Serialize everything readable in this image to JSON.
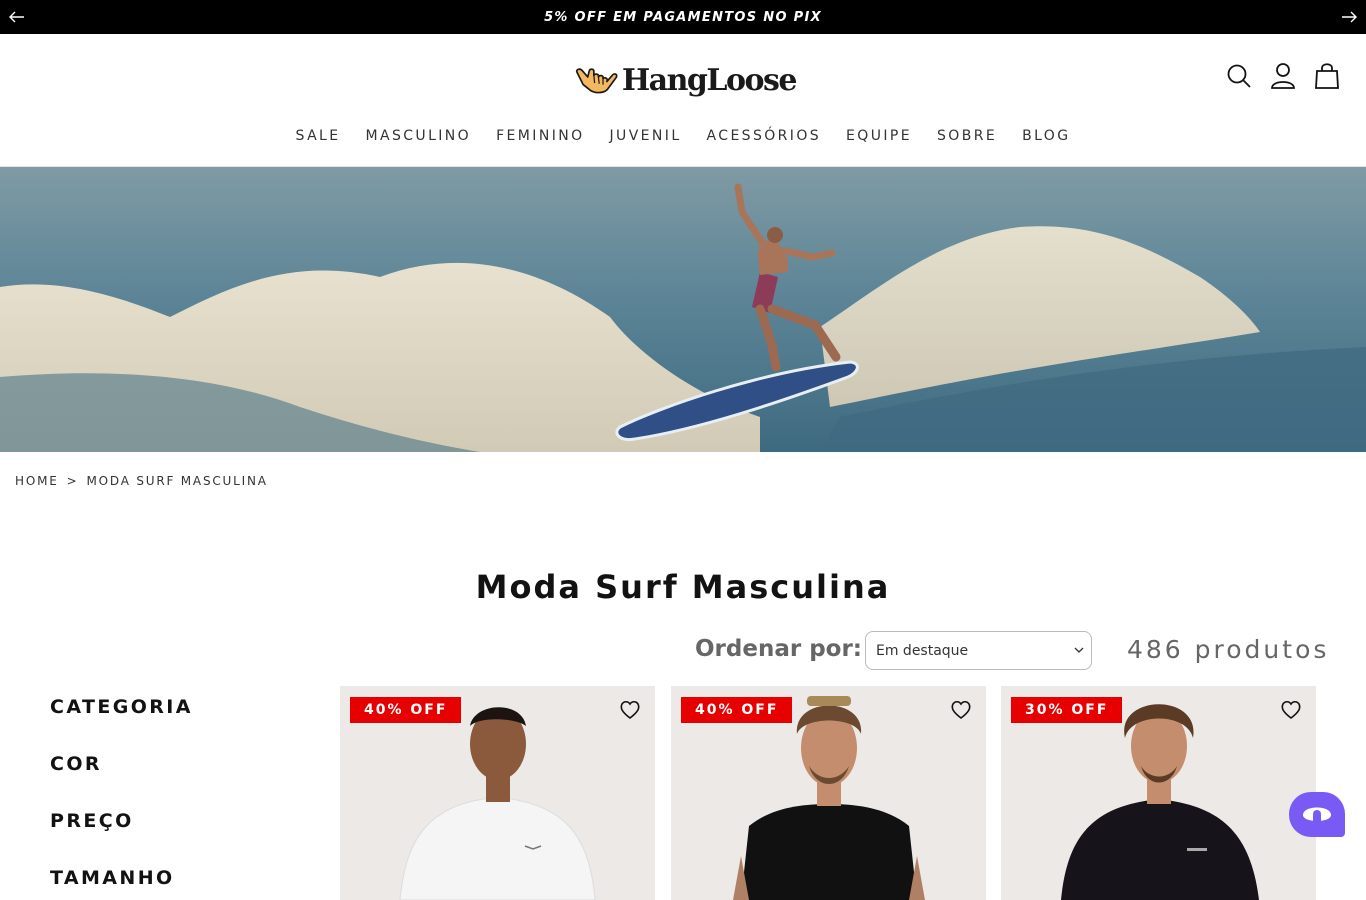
{
  "announcement": {
    "text": "5% OFF EM PAGAMENTOS NO PIX"
  },
  "header": {
    "logo_text": "HangLoose",
    "nav": [
      "SALE",
      "MASCULINO",
      "FEMININO",
      "JUVENIL",
      "ACESSÓRIOS",
      "EQUIPE",
      "SOBRE",
      "BLOG"
    ],
    "icons": [
      "search-icon",
      "account-icon",
      "bag-icon"
    ]
  },
  "breadcrumb": {
    "home": "HOME",
    "separator": ">",
    "current": "MODA SURF MASCULINA"
  },
  "page": {
    "title": "Moda Surf Masculina"
  },
  "sort": {
    "label": "Ordenar por:",
    "selected": "Em destaque",
    "count": "486 produtos"
  },
  "filters": [
    "CATEGORIA",
    "COR",
    "PREÇO",
    "TAMANHO"
  ],
  "products": [
    {
      "badge": "40% OFF",
      "shirt_color": "#f5f5f5"
    },
    {
      "badge": "40% OFF",
      "shirt_color": "#111111"
    },
    {
      "badge": "30% OFF",
      "shirt_color": "#16141a"
    }
  ],
  "colors": {
    "accent_badge": "#e60000",
    "chat": "#7a5af5",
    "announcement_bg": "#000000"
  }
}
